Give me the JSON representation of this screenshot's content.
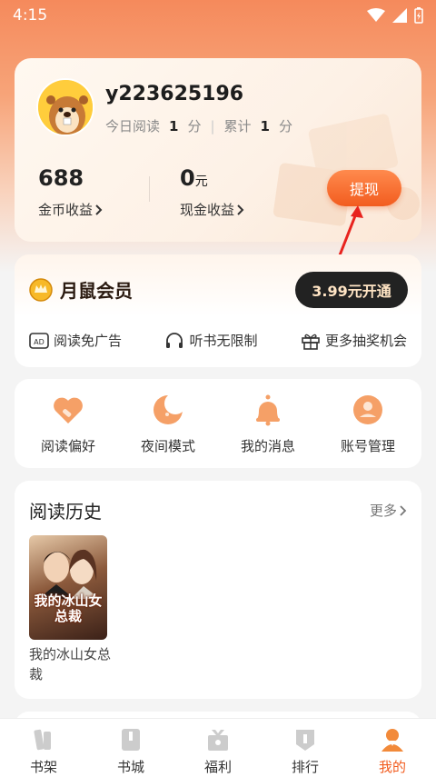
{
  "status_bar": {
    "time": "4:15"
  },
  "user": {
    "username": "y223625196",
    "today_label": "今日阅读",
    "today_value": "1",
    "today_unit": "分",
    "total_label": "累计",
    "total_value": "1",
    "total_unit": "分"
  },
  "earnings": {
    "coins_value": "688",
    "coins_label": "金币收益",
    "cash_value": "0",
    "cash_unit": "元",
    "cash_label": "现金收益",
    "withdraw_label": "提现"
  },
  "vip": {
    "title": "月鼠会员",
    "button": "3.99元开通",
    "perks": [
      "阅读免广告",
      "听书无限制",
      "更多抽奖机会"
    ]
  },
  "tools": [
    "阅读偏好",
    "夜间模式",
    "我的消息",
    "账号管理"
  ],
  "history": {
    "title": "阅读历史",
    "more": "更多",
    "books": [
      {
        "name": "我的冰山女总裁",
        "cover_title": "我的冰山女总裁"
      }
    ]
  },
  "tabs": [
    {
      "label": "书架",
      "active": false
    },
    {
      "label": "书城",
      "active": false
    },
    {
      "label": "福利",
      "active": false
    },
    {
      "label": "排行",
      "active": false
    },
    {
      "label": "我的",
      "active": true
    }
  ],
  "colors": {
    "accent": "#f25c1f",
    "header": "#f58a5c",
    "dark_button": "#222222"
  }
}
